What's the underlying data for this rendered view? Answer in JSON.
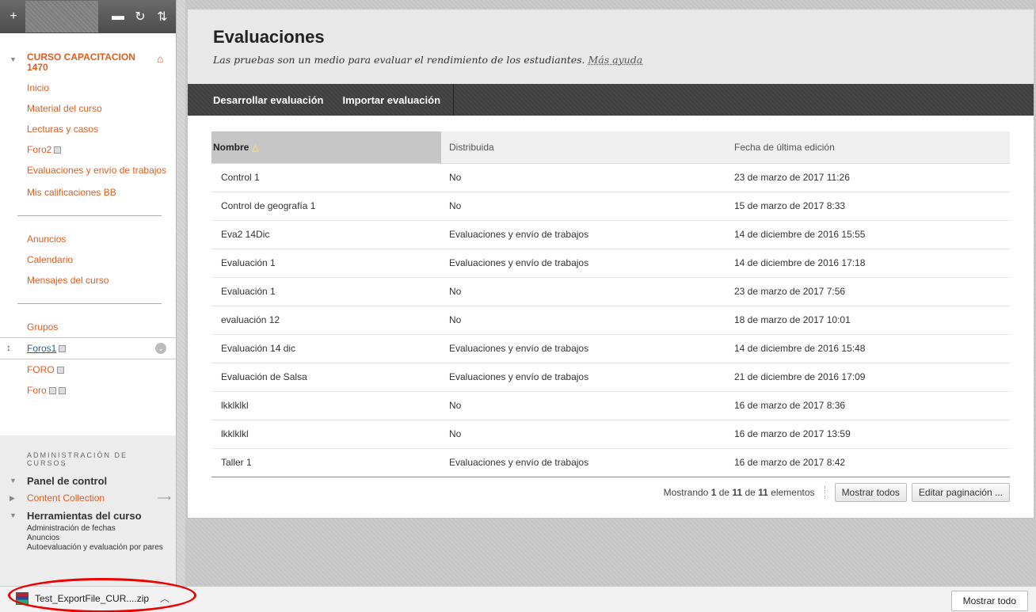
{
  "sidebar": {
    "course_title": "CURSO CAPACITACION 1470",
    "menu_a": [
      {
        "label": "Inicio"
      },
      {
        "label": "Material del curso"
      },
      {
        "label": "Lecturas y casos"
      },
      {
        "label": "Foro2"
      },
      {
        "label": "Evaluaciones y envío de trabajos"
      },
      {
        "label": "Mis calificaciones BB"
      }
    ],
    "menu_b": [
      {
        "label": "Anuncios"
      },
      {
        "label": "Calendario"
      },
      {
        "label": "Mensajes del curso"
      }
    ],
    "menu_c": [
      {
        "label": "Grupos"
      },
      {
        "label": "Foros1"
      },
      {
        "label": "FORO"
      },
      {
        "label": "Foro"
      }
    ],
    "admin": {
      "title": "ADMINISTRACIÓN DE CURSOS",
      "panel": "Panel de control",
      "content_collection": "Content Collection",
      "tools": "Herramientas del curso",
      "tool_items": [
        "Administración de fechas",
        "Anuncios",
        "Autoevaluación y evaluación por pares"
      ]
    }
  },
  "header": {
    "title": "Evaluaciones",
    "subtitle": "Las pruebas son un medio para evaluar el rendimiento de los estudiantes.",
    "help_link": "Más ayuda"
  },
  "actions": {
    "develop": "Desarrollar evaluación",
    "import": "Importar evaluación"
  },
  "table": {
    "columns": [
      "Nombre",
      "Distribuida",
      "Fecha de última edición"
    ],
    "rows": [
      [
        "Control 1",
        "No",
        "23 de marzo de 2017 11:26"
      ],
      [
        "Control de geografía 1",
        "No",
        "15 de marzo de 2017 8:33"
      ],
      [
        "Eva2 14Dic",
        "Evaluaciones y envío de trabajos",
        "14 de diciembre de 2016 15:55"
      ],
      [
        "Evaluación 1",
        "Evaluaciones y envío de trabajos",
        "14 de diciembre de 2016 17:18"
      ],
      [
        "Evaluación 1",
        "No",
        "23 de marzo de 2017 7:56"
      ],
      [
        "evaluación 12",
        "No",
        "18 de marzo de 2017 10:01"
      ],
      [
        "Evaluación 14 dic",
        "Evaluaciones y envío de trabajos",
        "14 de diciembre de 2016 15:48"
      ],
      [
        "Evaluación de Salsa",
        "Evaluaciones y envío de trabajos",
        "21 de diciembre de 2016 17:09"
      ],
      [
        "lkklklkl",
        "No",
        "16 de marzo de 2017 8:36"
      ],
      [
        "lkklklkl",
        "No",
        "16 de marzo de 2017 13:59"
      ],
      [
        "Taller 1",
        "Evaluaciones y envío de trabajos",
        "16 de marzo de 2017 8:42"
      ]
    ]
  },
  "pagination": {
    "prefix": "Mostrando",
    "from": "1",
    "de1": "de",
    "to": "11",
    "de2": "de",
    "total": "11",
    "suffix": "elementos",
    "show_all": "Mostrar todos",
    "edit": "Editar paginación ..."
  },
  "download": {
    "filename": "Test_ExportFile_CUR....zip",
    "show_all": "Mostrar todo"
  },
  "colors": {
    "accent_orange": "#e55b1c",
    "highlight_red": "#e00000"
  }
}
